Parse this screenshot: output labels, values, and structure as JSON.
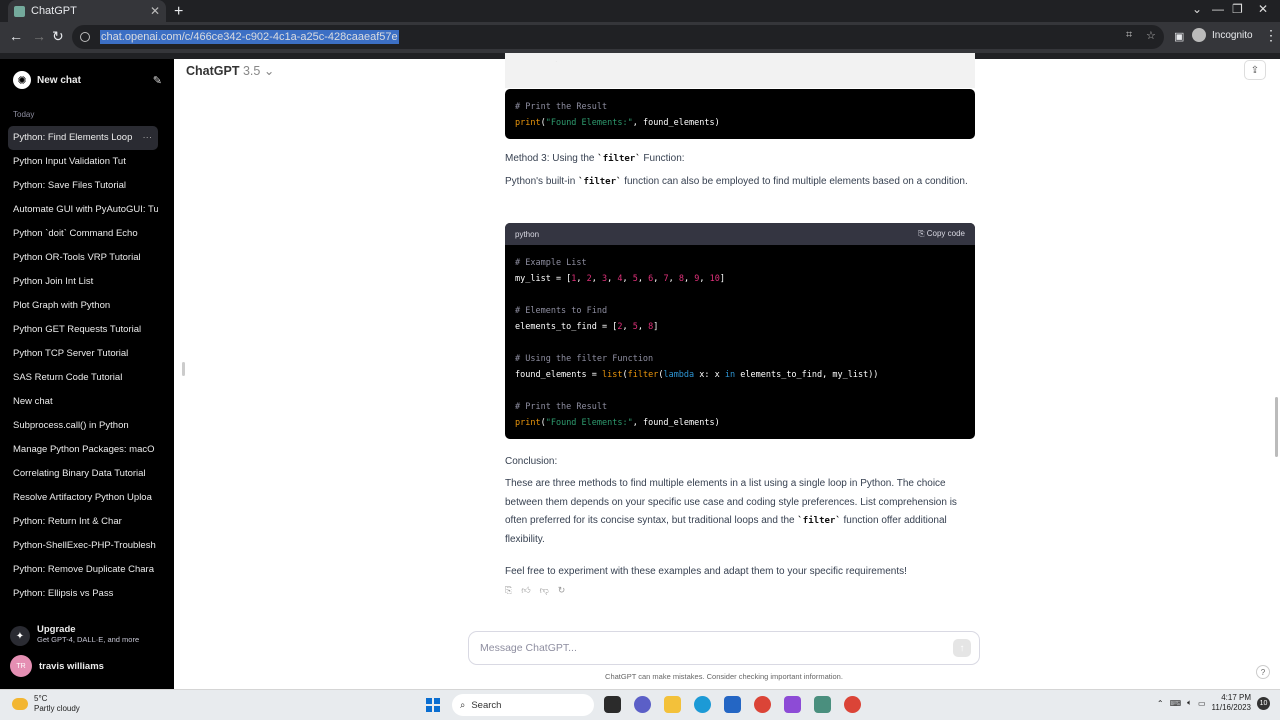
{
  "browser": {
    "tab_title": "ChatGPT",
    "url": "chat.openai.com/c/466ce342-c902-4c1a-a25c-428caaeaf57e",
    "profile": "Incognito"
  },
  "sidebar": {
    "new_chat": "New chat",
    "today_label": "Today",
    "items": [
      {
        "label": "Python: Find Elements Loop"
      },
      {
        "label": "Python Input Validation Tut"
      },
      {
        "label": "Python: Save Files Tutorial"
      },
      {
        "label": "Automate GUI with PyAutoGUI: Tu"
      },
      {
        "label": "Python `doit` Command Echo"
      },
      {
        "label": "Python OR-Tools VRP Tutorial"
      },
      {
        "label": "Python Join Int List"
      },
      {
        "label": "Plot Graph with Python"
      },
      {
        "label": "Python GET Requests Tutorial"
      },
      {
        "label": "Python TCP Server Tutorial"
      },
      {
        "label": "SAS Return Code Tutorial"
      },
      {
        "label": "New chat"
      },
      {
        "label": "Subprocess.call() in Python"
      },
      {
        "label": "Manage Python Packages: macO"
      },
      {
        "label": "Correlating Binary Data Tutorial"
      },
      {
        "label": "Resolve Artifactory Python Uploa"
      },
      {
        "label": "Python: Return Int & Char"
      },
      {
        "label": "Python-ShellExec-PHP-Troublesh"
      },
      {
        "label": "Python: Remove Duplicate Chara"
      },
      {
        "label": "Python: Ellipsis vs Pass"
      }
    ],
    "upgrade_title": "Upgrade",
    "upgrade_sub": "Get GPT-4, DALL·E, and more",
    "user_initials": "TR",
    "user_name": "travis williams"
  },
  "header": {
    "model_name": "ChatGPT",
    "model_version": "3.5"
  },
  "chat": {
    "prev_comment": "# Print the Result",
    "prev_print_fn": "print",
    "prev_print_str": "\"Found Elements:\"",
    "prev_print_rest": ", found_elements)",
    "method3_pre": "Method 3: Using the ",
    "method3_code": "`filter`",
    "method3_post": " Function:",
    "desc_pre": "Python's built-in ",
    "desc_code": "`filter`",
    "desc_post": " function can also be employed to find multiple elements based on a condition.",
    "code_lang": "python",
    "copy_label": "Copy code",
    "c1": "# Example List",
    "c2": "# Elements to Find",
    "c3": "# Using the filter Function",
    "c4": "# Print the Result",
    "conclusion_label": "Conclusion:",
    "conclusion_pre": "These are three methods to find multiple elements in a list using a single loop in Python. The choice between them depends on your specific use case and coding style preferences. List comprehension is often preferred for its concise syntax, but traditional loops and the ",
    "conclusion_code": "`filter`",
    "conclusion_post": " function offer additional flexibility.",
    "closing": "Feel free to experiment with these examples and adapt them to your specific requirements!"
  },
  "composer": {
    "placeholder": "Message ChatGPT...",
    "disclaimer": "ChatGPT can make mistakes. Consider checking important information."
  },
  "taskbar": {
    "temp": "5°C",
    "weather": "Partly cloudy",
    "search": "Search",
    "time": "4:17 PM",
    "date": "11/16/2023",
    "notif_count": "10"
  }
}
